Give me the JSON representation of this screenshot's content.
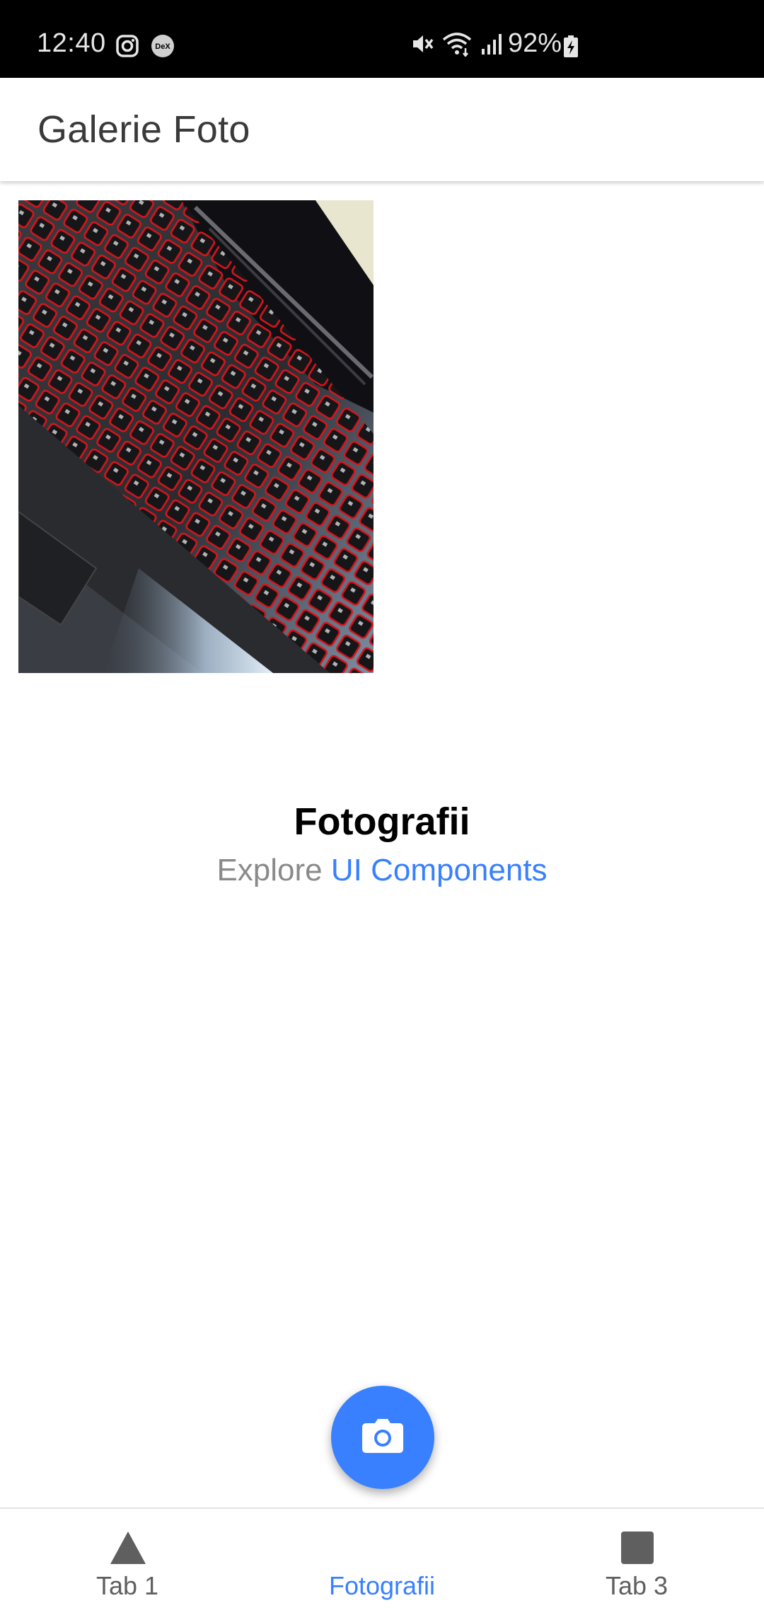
{
  "status_bar": {
    "time": "12:40",
    "battery": "92%",
    "icons": [
      "instagram-icon",
      "dex-icon",
      "mute-icon",
      "wifi-icon",
      "signal-icon",
      "battery-charging-icon"
    ]
  },
  "toolbar": {
    "title": "Galerie Foto"
  },
  "gallery": {
    "photos": [
      {
        "subject": "laptop-keyboard-photo"
      }
    ]
  },
  "empty_state": {
    "title": "Fotografii",
    "subtitle_prefix": "Explore",
    "subtitle_link": "UI Components"
  },
  "fab": {
    "icon": "camera-icon"
  },
  "tabs": [
    {
      "label": "Tab 1",
      "icon": "triangle-icon",
      "selected": false
    },
    {
      "label": "Fotografii",
      "icon": "images-icon",
      "selected": true
    },
    {
      "label": "Tab 3",
      "icon": "square-icon",
      "selected": false
    }
  ],
  "colors": {
    "accent": "#3880ff",
    "tab_inactive": "#5f5f5f",
    "status_bar_bg": "#000000"
  }
}
